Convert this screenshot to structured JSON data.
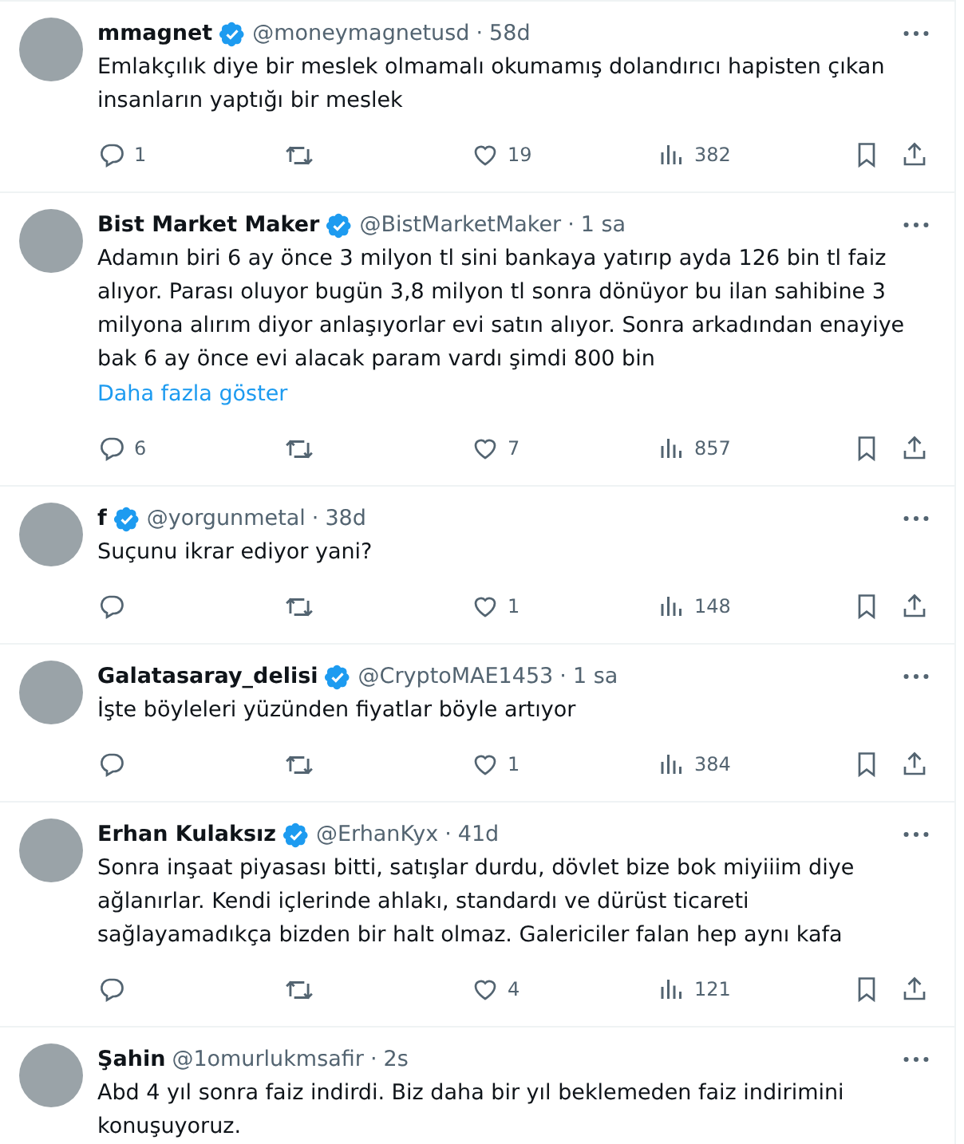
{
  "tweets": [
    {
      "name": "mmagnet",
      "verified": true,
      "handle": "@moneymagnetusd",
      "separator": "·",
      "time": "58d",
      "text": "Emlakçılık diye bir meslek olmamalı okumamış dolandırıcı hapisten çıkan insanların yaptığı bir meslek",
      "actions": {
        "replies": "1",
        "likes": "19",
        "views": "382"
      }
    },
    {
      "name": "Bist Market Maker",
      "verified": true,
      "handle": "@BistMarketMaker",
      "separator": "·",
      "time": "1 sa",
      "text": "Adamın biri 6 ay önce 3 milyon tl sini bankaya yatırıp ayda 126 bin tl faiz alıyor. Parası oluyor bugün 3,8 milyon tl sonra dönüyor bu ilan sahibine 3 milyona alırım diyor anlaşıyorlar evi satın alıyor. Sonra arkadından enayiye bak 6 ay önce evi alacak param vardı şimdi 800 bin",
      "show_more": "Daha fazla göster",
      "actions": {
        "replies": "6",
        "likes": "7",
        "views": "857"
      }
    },
    {
      "name": "f",
      "verified": true,
      "handle": "@yorgunmetal",
      "separator": "·",
      "time": "38d",
      "text": "Suçunu ikrar ediyor yani?",
      "actions": {
        "likes": "1",
        "views": "148"
      }
    },
    {
      "name": "Galatasaray_delisi",
      "verified": true,
      "handle": "@CryptoMAE1453",
      "separator": "·",
      "time": "1 sa",
      "text": "İşte böyleleri yüzünden fiyatlar böyle artıyor",
      "actions": {
        "likes": "1",
        "views": "384"
      }
    },
    {
      "name": "Erhan Kulaksız",
      "verified": true,
      "handle": "@ErhanKyx",
      "separator": "·",
      "time": "41d",
      "text": "Sonra inşaat piyasası bitti, satışlar durdu, dövlet bize bok miyiiim diye ağlanırlar. Kendi içlerinde ahlakı, standardı ve dürüst ticareti sağlayamadıkça bizden bir halt olmaz. Galericiler falan hep aynı kafa",
      "actions": {
        "likes": "4",
        "views": "121"
      }
    },
    {
      "name": "Şahin",
      "verified": false,
      "handle": "@1omurlukmsafir",
      "separator": "·",
      "time": "2s",
      "text": "Abd 4 yıl sonra faiz indirdi. Biz daha bir yıl beklemeden faiz indirimini konuşuyoruz."
    }
  ]
}
